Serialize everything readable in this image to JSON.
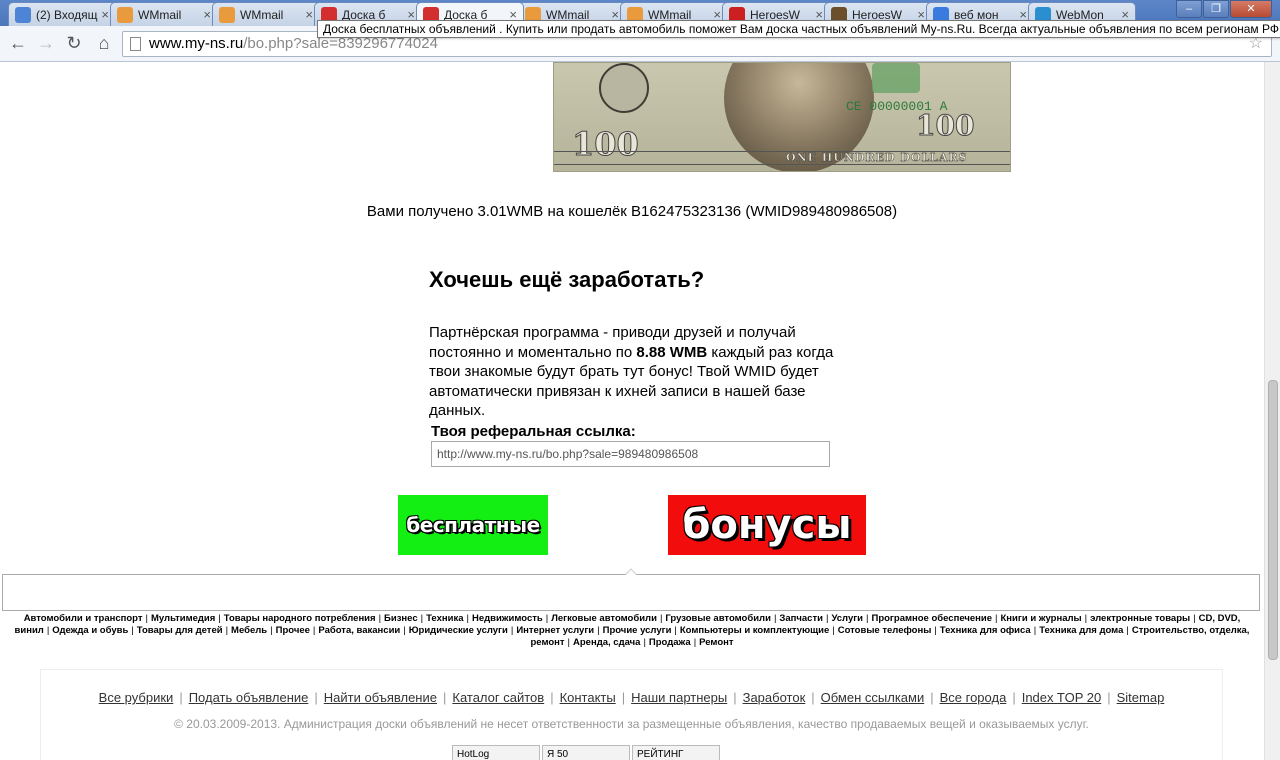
{
  "browser": {
    "tabs": [
      {
        "title": "(2) Входящ",
        "icon_color": "#4e84d6",
        "icon": "mail-icon",
        "active": false
      },
      {
        "title": "WMmail",
        "icon_color": "#e89a3c",
        "icon": "wmmail-icon",
        "active": false
      },
      {
        "title": "WMmail",
        "icon_color": "#e89a3c",
        "icon": "wmmail-icon",
        "active": false
      },
      {
        "title": "Доска б",
        "icon_color": "#d32f2f",
        "icon": "ru-flag-icon",
        "active": false
      },
      {
        "title": "Доска б",
        "icon_color": "#d32f2f",
        "icon": "ru-flag-icon",
        "active": true
      },
      {
        "title": "WMmail",
        "icon_color": "#e89a3c",
        "icon": "wmmail-icon",
        "active": false
      },
      {
        "title": "WMmail",
        "icon_color": "#e89a3c",
        "icon": "wmmail-icon",
        "active": false
      },
      {
        "title": "HeroesW",
        "icon_color": "#cc1f1f",
        "icon": "youtube-icon",
        "active": false
      },
      {
        "title": "HeroesW",
        "icon_color": "#6b4e2a",
        "icon": "heroes-icon",
        "active": false
      },
      {
        "title": "веб мон",
        "icon_color": "#3b7be0",
        "icon": "google-icon",
        "active": false
      },
      {
        "title": "WebMon",
        "icon_color": "#2a8fcf",
        "icon": "globe-icon",
        "active": false
      }
    ],
    "url_host": "www.my-ns.ru",
    "url_path": "/bo.php?sale=839296774024",
    "tooltip": "Доска бесплатных объявлений . Купить или продать автомобиль поможет Вам доска частных объявлений My-ns.Ru. Всегда актуальные объявления по всем регионам РФ."
  },
  "banknote": {
    "serial": "CE 00000001 A",
    "number": "100",
    "band": "ONE HUNDRED DOLLARS"
  },
  "received_text": "Вами получено 3.01WMB на кошелёк B162475323136 (WMID989480986508)",
  "promo": {
    "heading": "Хочешь ещё заработать?",
    "text_before": "Партнёрская программа - приводи друзей и получай постоянно и моментально по ",
    "amount": "8.88 WMB",
    "text_after": " каждый раз когда твои знакомые будут брать тут бонус! Твой WMID будет автоматически привязан к ихней записи в нашей базе данных.",
    "ref_label": "Твоя реферальная ссылка:",
    "ref_value": "http://www.my-ns.ru/bo.php?sale=989480986508"
  },
  "buttons": {
    "free": "бесплатные",
    "bonus": "бонусы",
    "free_color": "#13ef13",
    "bonus_color": "#f20c0c"
  },
  "categories": [
    "Автомобили и транспорт",
    "Мультимедия",
    "Товары народного потребления",
    "Бизнес",
    "Техника",
    "Недвижимость",
    "Легковые автомобили",
    "Грузовые автомобили",
    "Запчасти",
    "Услуги",
    "Програмное обеспечение",
    "Книги и журналы",
    "электронные товары",
    "CD, DVD, винил",
    "Одежда и обувь",
    "Товары для детей",
    "Мебель",
    "Прочее",
    "Работа, вакансии",
    "Юридические услуги",
    "Интернет услуги",
    "Прочие услуги",
    "Компьютеры и комплектующие",
    "Сотовые телефоны",
    "Техника для офиса",
    "Техника для дома",
    "Строительство, отделка, ремонт",
    "Аренда, сдача",
    "Продажа",
    "Ремонт"
  ],
  "footer": {
    "links": [
      "Все рубрики",
      "Подать объявление",
      "Найти объявление",
      "Каталог сайтов",
      "Контакты",
      "Наши партнеры",
      "Заработок",
      "Обмен ссылками",
      "Все города",
      "Index TOP 20",
      "Sitemap"
    ],
    "copyright": "© 20.03.2009-2013. Администрация доски объявлений не несет ответственности за размещенные объявления, качество продаваемых вещей и оказываемых услуг.",
    "counters": [
      "HotLog",
      "Я 50",
      "РЕЙТИНГ"
    ]
  }
}
